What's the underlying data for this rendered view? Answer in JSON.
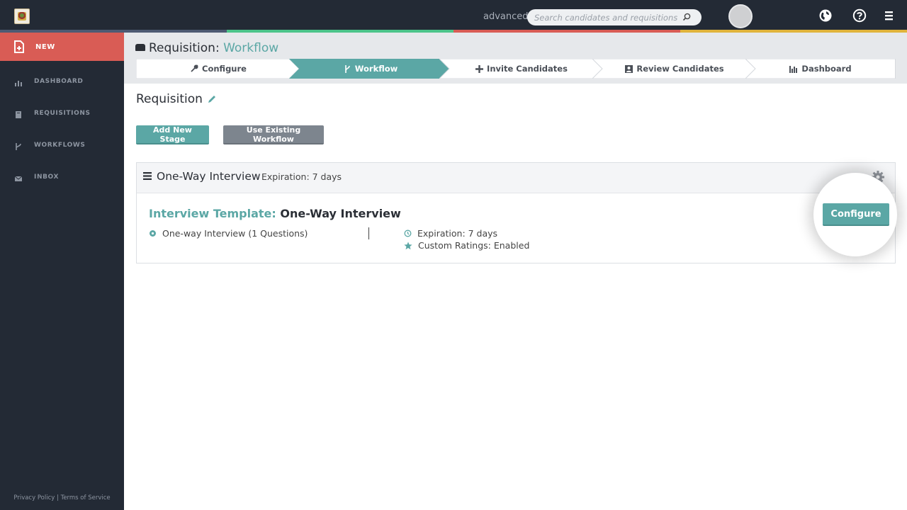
{
  "topbar": {
    "mode_label": "advanced",
    "search_placeholder": "Search candidates and requisitions",
    "stripe_colors": [
      "#4d5a73",
      "#4cc48a",
      "#d95c55",
      "#e0b43c"
    ]
  },
  "sidebar": {
    "new_label": "NEW",
    "items": [
      {
        "label": "DASHBOARD",
        "icon": "bar-chart-icon"
      },
      {
        "label": "REQUISITIONS",
        "icon": "document-icon"
      },
      {
        "label": "WORKFLOWS",
        "icon": "branch-icon"
      },
      {
        "label": "INBOX",
        "icon": "envelope-icon"
      }
    ],
    "footer": {
      "privacy": "Privacy Policy",
      "separator": " | ",
      "terms": "Terms of Service"
    }
  },
  "header": {
    "title_prefix": "Requisition:",
    "title_accent": "Workflow"
  },
  "wizard": {
    "steps": [
      {
        "label": "Configure",
        "icon": "wrench-icon",
        "active": false
      },
      {
        "label": "Workflow",
        "icon": "branch-icon",
        "active": true
      },
      {
        "label": "Invite Candidates",
        "icon": "plus-icon",
        "active": false
      },
      {
        "label": "Review Candidates",
        "icon": "contact-icon",
        "active": false
      },
      {
        "label": "Dashboard",
        "icon": "bar-chart-icon",
        "active": false
      }
    ]
  },
  "content": {
    "requisition_title": "Requisition",
    "add_stage_label": "Add New Stage",
    "use_workflow_label": "Use Existing Workflow",
    "stage": {
      "name": "One-Way Interview",
      "expiration": "Expiration: 7 days",
      "template_key": "Interview Template:",
      "template_value": "One-Way Interview",
      "question_info": "One-way Interview (1 Questions)",
      "expiration_detail": "Expiration: 7 days",
      "ratings": "Custom Ratings: Enabled",
      "configure_label": "Configure"
    }
  },
  "colors": {
    "accent": "#5ba7a5",
    "nav_bg": "#232a35",
    "new_button": "#d95c55"
  }
}
